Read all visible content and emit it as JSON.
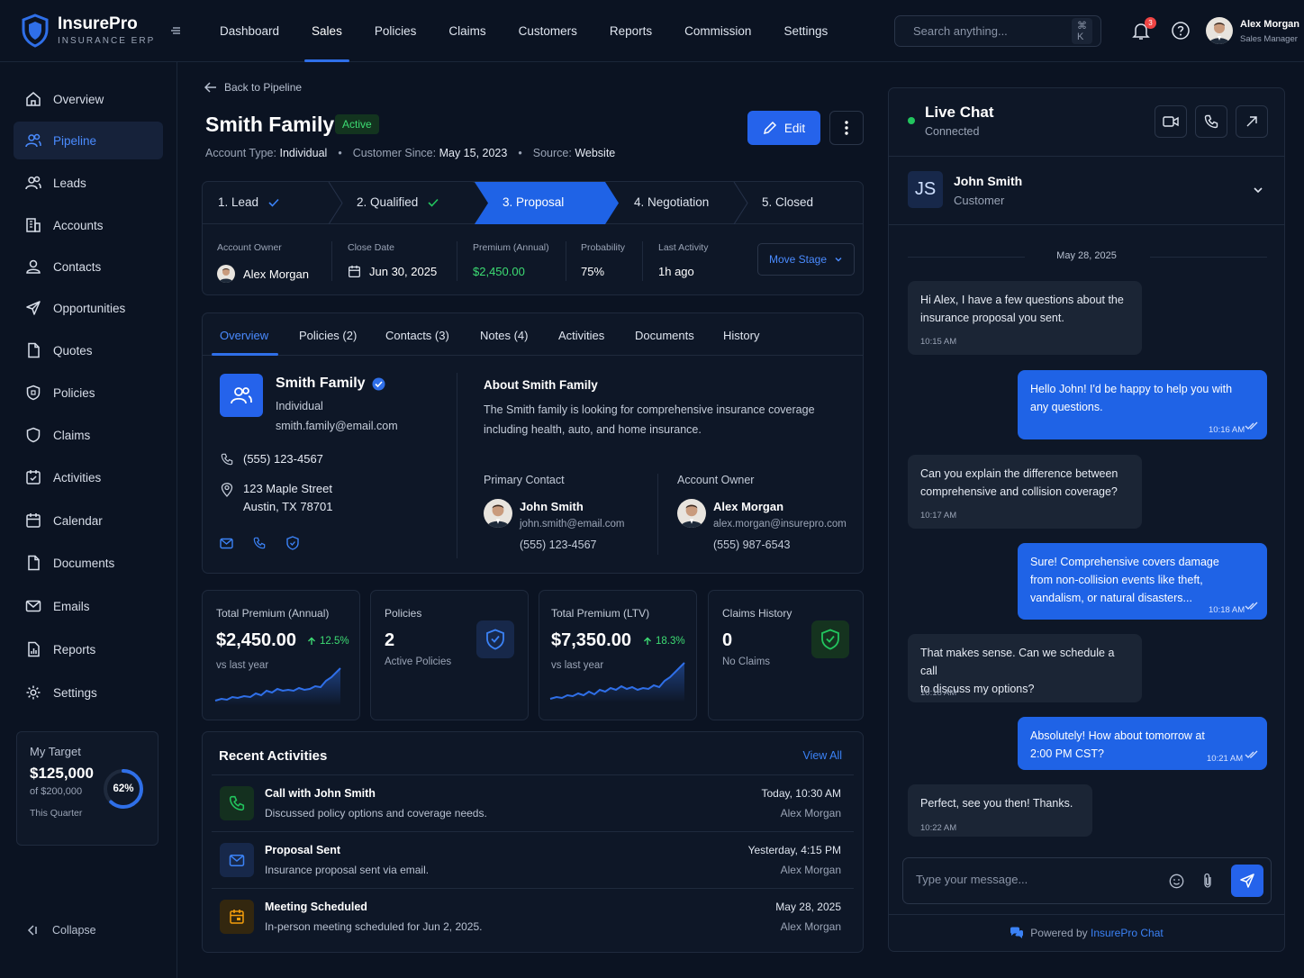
{
  "brand": {
    "name": "InsurePro",
    "subtitle": "INSURANCE ERP"
  },
  "topnav": {
    "items": [
      "Dashboard",
      "Sales",
      "Policies",
      "Claims",
      "Customers",
      "Reports",
      "Commission",
      "Settings"
    ],
    "active": "Sales"
  },
  "search": {
    "placeholder": "Search anything...",
    "shortcut": "⌘ K"
  },
  "notifications": {
    "count": "3"
  },
  "user": {
    "name": "Alex Morgan",
    "role": "Sales Manager"
  },
  "sidebar": {
    "items": [
      {
        "label": "Overview",
        "icon": "home-icon"
      },
      {
        "label": "Pipeline",
        "icon": "users-icon",
        "active": true
      },
      {
        "label": "Leads",
        "icon": "leads-icon"
      },
      {
        "label": "Accounts",
        "icon": "building-icon"
      },
      {
        "label": "Contacts",
        "icon": "user-icon"
      },
      {
        "label": "Opportunities",
        "icon": "send-icon"
      },
      {
        "label": "Quotes",
        "icon": "file-icon"
      },
      {
        "label": "Policies",
        "icon": "shield-icon"
      },
      {
        "label": "Claims",
        "icon": "clipboard-icon"
      },
      {
        "label": "Activities",
        "icon": "calendar-check-icon"
      },
      {
        "label": "Calendar",
        "icon": "calendar-icon"
      },
      {
        "label": "Documents",
        "icon": "document-icon"
      },
      {
        "label": "Emails",
        "icon": "mail-icon"
      },
      {
        "label": "Reports",
        "icon": "chart-icon"
      },
      {
        "label": "Settings",
        "icon": "gear-icon"
      }
    ],
    "target": {
      "title": "My Target",
      "value": "$125,000",
      "of": "of $200,000",
      "percent": "62%",
      "fraction": 0.62,
      "period": "This Quarter"
    },
    "collapse": "Collapse"
  },
  "main": {
    "back": "Back to Pipeline",
    "title": "Smith Family",
    "status": "Active",
    "meta": {
      "account_type_label": "Account Type:",
      "account_type": "Individual",
      "since_label": "Customer Since:",
      "since": "May 15, 2023",
      "source_label": "Source:",
      "source": "Website"
    },
    "edit": "Edit",
    "stages": [
      "1. Lead",
      "2. Qualified",
      "3. Proposal",
      "4. Negotiation",
      "5. Closed"
    ],
    "details": {
      "owner_label": "Account Owner",
      "owner": "Alex Morgan",
      "close_label": "Close Date",
      "close": "Jun 30, 2025",
      "premium_label": "Premium (Annual)",
      "premium": "$2,450.00",
      "prob_label": "Probability",
      "prob": "75%",
      "activity_label": "Last Activity",
      "activity": "1h ago",
      "move_stage": "Move Stage"
    },
    "tabs": [
      "Overview",
      "Policies (2)",
      "Contacts (3)",
      "Notes (4)",
      "Activities",
      "Documents",
      "History"
    ],
    "profile": {
      "name": "Smith Family",
      "type": "Individual",
      "email": "smith.family@email.com",
      "phone": "(555) 123-4567",
      "address1": "123 Maple Street",
      "address2": "Austin, TX 78701"
    },
    "about": {
      "title": "About Smith Family",
      "line1": "The Smith family is looking for comprehensive insurance coverage",
      "line2": "including health, auto, and home insurance.",
      "primary_label": "Primary Contact",
      "primary_name": "John Smith",
      "primary_email": "john.smith@email.com",
      "primary_phone": "(555) 123-4567",
      "owner_label": "Account Owner",
      "owner_name": "Alex Morgan",
      "owner_email": "alex.morgan@insurepro.com",
      "owner_phone": "(555) 987-6543"
    },
    "stats": [
      {
        "title": "Total Premium (Annual)",
        "value": "$2,450.00",
        "delta": "12.5%",
        "sub": "vs last year"
      },
      {
        "title": "Policies",
        "value": "2",
        "sub": "Active Policies"
      },
      {
        "title": "Total Premium (LTV)",
        "value": "$7,350.00",
        "delta": "18.3%",
        "sub": "vs last year"
      },
      {
        "title": "Claims History",
        "value": "0",
        "sub": "No Claims"
      }
    ],
    "activities": {
      "title": "Recent Activities",
      "view_all": "View All",
      "items": [
        {
          "title": "Call with John Smith",
          "desc": "Discussed policy options and coverage needs.",
          "time": "Today, 10:30 AM",
          "who": "Alex Morgan"
        },
        {
          "title": "Proposal Sent",
          "desc": "Insurance proposal sent via email.",
          "time": "Yesterday, 4:15 PM",
          "who": "Alex Morgan"
        },
        {
          "title": "Meeting Scheduled",
          "desc": "In-person meeting scheduled for Jun 2, 2025.",
          "time": "May 28, 2025",
          "who": "Alex Morgan"
        }
      ]
    }
  },
  "chat": {
    "title": "Live Chat",
    "status": "Connected",
    "contact": {
      "initials": "JS",
      "name": "John Smith",
      "role": "Customer"
    },
    "date": "May 28, 2025",
    "messages": [
      {
        "dir": "in",
        "line1": "Hi Alex, I have a few questions about the",
        "line2": "insurance proposal you sent.",
        "time": "10:15 AM"
      },
      {
        "dir": "out",
        "line1": "Hello John! I'd be happy to help you with",
        "line2": "any questions.",
        "time": "10:16 AM"
      },
      {
        "dir": "in",
        "line1": "Can you explain the difference between",
        "line2": "comprehensive and collision coverage?",
        "time": "10:17 AM"
      },
      {
        "dir": "out",
        "line1": "Sure! Comprehensive covers damage",
        "line2": "from non-collision events like theft,",
        "line3": "vandalism, or natural disasters...",
        "time": "10:18 AM"
      },
      {
        "dir": "in",
        "line1": "That makes sense. Can we schedule a call",
        "line2": "to discuss my options?",
        "time": "10:18 AM"
      },
      {
        "dir": "out",
        "line1": "Absolutely! How about tomorrow at",
        "line2": "2:00 PM CST?",
        "time": "10:21 AM"
      },
      {
        "dir": "in",
        "line1": "Perfect, see you then! Thanks.",
        "time": "10:22 AM"
      }
    ],
    "input_placeholder": "Type your message...",
    "powered_by": "Powered by",
    "powered_brand": "InsurePro Chat"
  }
}
